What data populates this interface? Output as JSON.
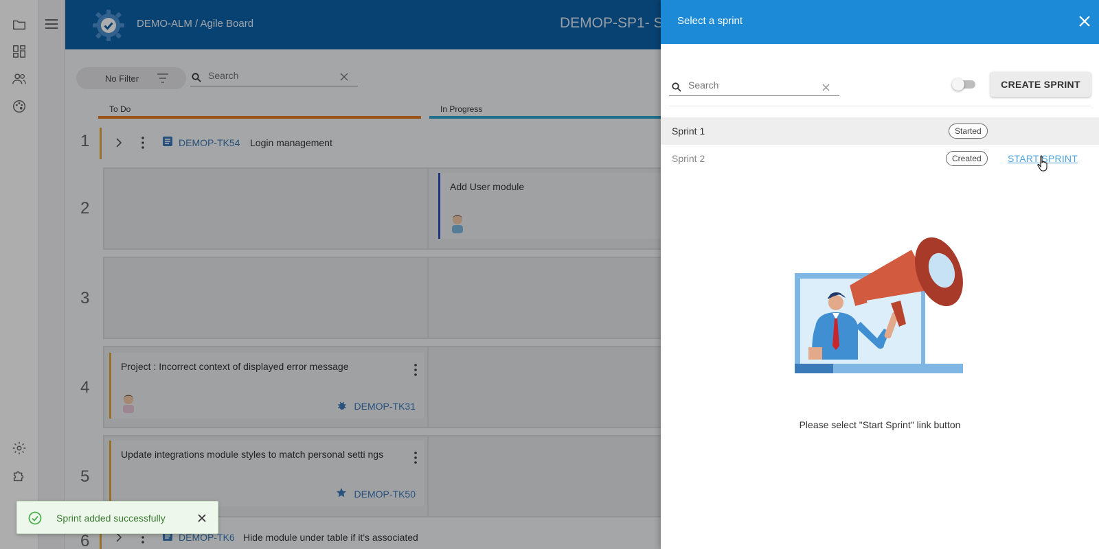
{
  "header": {
    "breadcrumb": "DEMO-ALM / Agile Board",
    "sprint_title": "DEMOP-SP1- S"
  },
  "board": {
    "filter_label": "No Filter",
    "search_placeholder": "Search",
    "columns": [
      {
        "label": "To Do",
        "color": "#e07b1f"
      },
      {
        "label": "In Progress",
        "color": "#2ea6c9"
      }
    ],
    "lanes": [
      {
        "number": "1",
        "key": "DEMOP-TK54",
        "title": "Login management"
      },
      {
        "number": "2"
      },
      {
        "number": "3"
      },
      {
        "number": "4"
      },
      {
        "number": "5"
      },
      {
        "number": "6",
        "key": "DEMOP-TK6",
        "title": "Hide module under table if it's associated"
      }
    ],
    "cards": {
      "add_user": {
        "title": "Add User module"
      },
      "incorrect": {
        "title": "Project : Incorrect context of displayed error message",
        "key": "DEMOP-TK31"
      },
      "update": {
        "title": "Update integrations module styles to match personal setti ngs",
        "key": "DEMOP-TK50"
      }
    }
  },
  "drawer": {
    "title": "Select a sprint",
    "search_placeholder": "Search",
    "create_label": "CREATE SPRINT",
    "sprints": [
      {
        "name": "Sprint 1",
        "status": "Started",
        "selected": true
      },
      {
        "name": "Sprint 2",
        "status": "Created",
        "action": "START SPRINT"
      }
    ],
    "hint": "Please select \"Start Sprint\" link button"
  },
  "toast": {
    "message": "Sprint added successfully"
  },
  "colors": {
    "topbar": "#0c62a8",
    "drawer_header": "#1c8ad6",
    "link": "#4fa3de",
    "success": "#4caf50"
  }
}
